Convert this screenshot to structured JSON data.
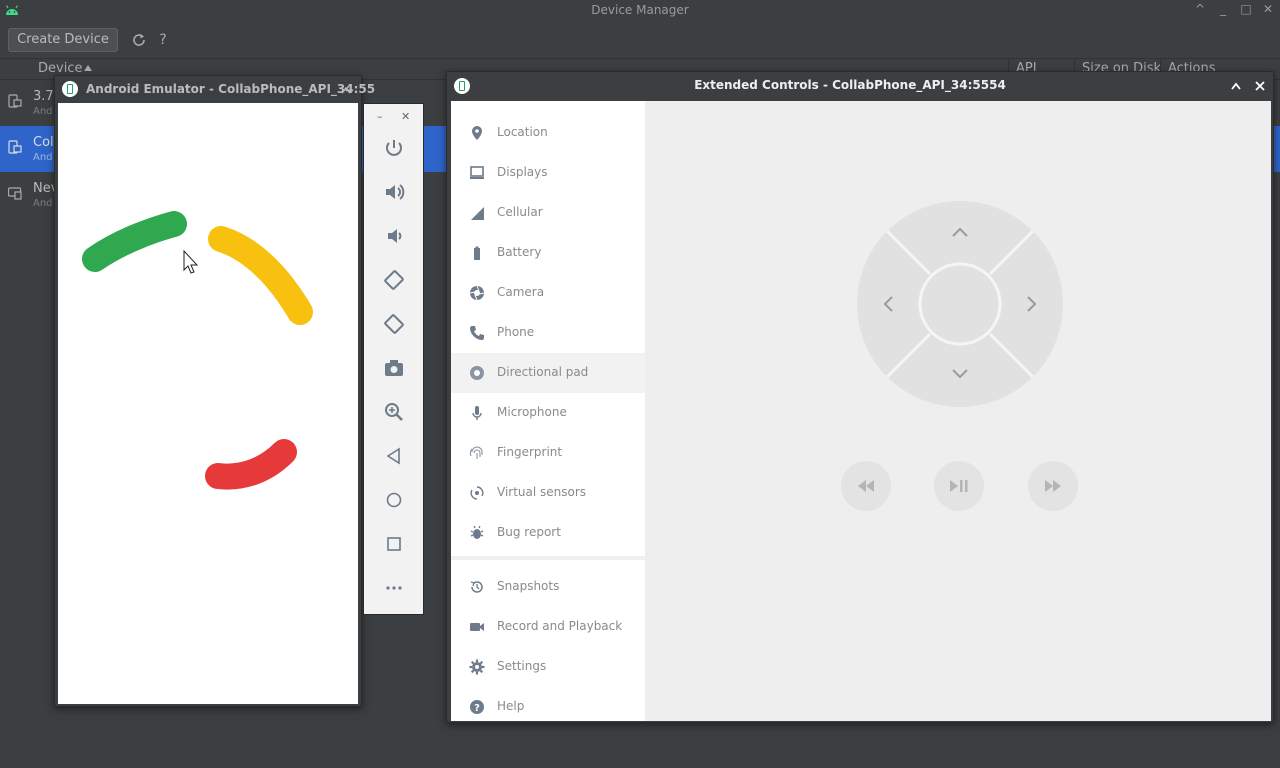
{
  "device_manager": {
    "title": "Device Manager",
    "create_device_label": "Create Device",
    "help_glyph": "?",
    "columns": {
      "device": "Device",
      "api": "API",
      "size": "Size on Disk",
      "actions": "Actions"
    },
    "rows": [
      {
        "name": "3.7",
        "sub": "And",
        "selected": false
      },
      {
        "name": "Col",
        "sub": "And",
        "selected": true
      },
      {
        "name": "Nev",
        "sub": "And",
        "selected": false
      }
    ],
    "window_controls": [
      "^",
      "_",
      "□",
      "✕"
    ]
  },
  "emulator": {
    "title": "Android Emulator - CollabPhone_API_34:55",
    "toolbar_icons": [
      "power-icon",
      "volume-up-icon",
      "volume-down-icon",
      "rotate-left-icon",
      "rotate-right-icon",
      "camera-icon",
      "zoom-icon",
      "back-icon",
      "home-icon",
      "overview-icon",
      "more-icon"
    ],
    "colors": {
      "green": "#2fa84f",
      "yellow": "#f8c10f",
      "red": "#e6393a"
    }
  },
  "extended_controls": {
    "title": "Extended Controls - CollabPhone_API_34:5554",
    "nav": [
      {
        "label": "Location",
        "icon": "location-pin-icon"
      },
      {
        "label": "Displays",
        "icon": "monitor-icon"
      },
      {
        "label": "Cellular",
        "icon": "signal-icon"
      },
      {
        "label": "Battery",
        "icon": "battery-icon"
      },
      {
        "label": "Camera",
        "icon": "camera-aperture-icon"
      },
      {
        "label": "Phone",
        "icon": "phone-icon"
      },
      {
        "label": "Directional pad",
        "icon": "dpad-icon",
        "active": true
      },
      {
        "label": "Microphone",
        "icon": "microphone-icon"
      },
      {
        "label": "Fingerprint",
        "icon": "fingerprint-icon"
      },
      {
        "label": "Virtual sensors",
        "icon": "rotation-icon"
      },
      {
        "label": "Bug report",
        "icon": "bug-icon"
      },
      {
        "label": "Snapshots",
        "icon": "history-icon"
      },
      {
        "label": "Record and Playback",
        "icon": "video-icon"
      },
      {
        "label": "Settings",
        "icon": "gear-icon"
      },
      {
        "label": "Help",
        "icon": "help-icon"
      }
    ],
    "media_buttons": [
      "rewind-icon",
      "play-pause-icon",
      "fast-forward-icon"
    ]
  }
}
